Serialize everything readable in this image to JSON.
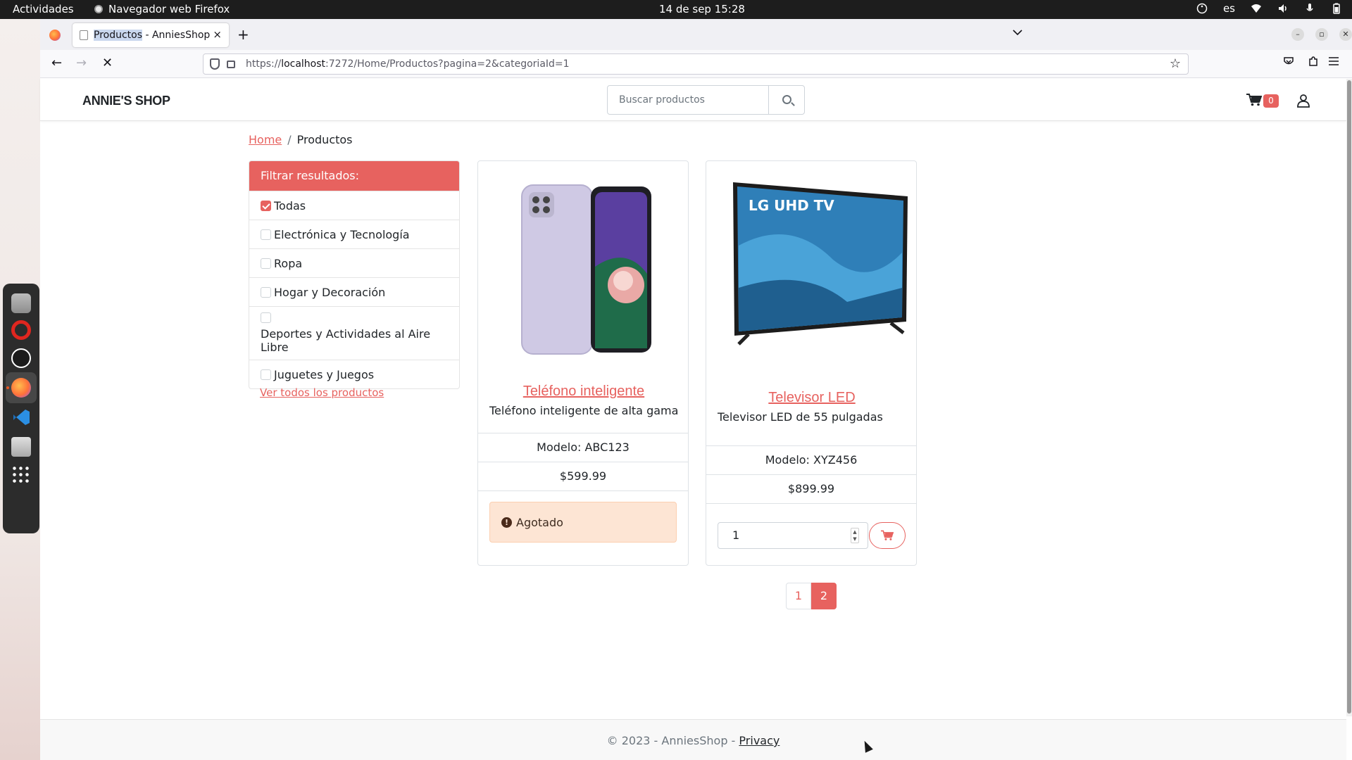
{
  "system": {
    "activities": "Actividades",
    "app_name": "Navegador web Firefox",
    "clock": "14 de sep  15:28",
    "language": "es"
  },
  "browser": {
    "tab_title_highlight": "Productos",
    "tab_title_rest": " - AnniesShop",
    "tab_close": "×",
    "new_tab": "+",
    "url_prefix": "https://",
    "url_host": "localhost",
    "url_rest": ":7272/Home/Productos?pagina=2&categoriaId=1",
    "star": "☆"
  },
  "site": {
    "brand": "ANNIE'S SHOP",
    "search_placeholder": "Buscar productos",
    "cart_count": "0",
    "accent_color": "#e7625f"
  },
  "breadcrumb": {
    "home": "Home",
    "separator": "/",
    "current": "Productos"
  },
  "filter": {
    "title": "Filtrar resultados:",
    "items": [
      {
        "label": "Todas",
        "checked": true
      },
      {
        "label": "Electrónica y Tecnología",
        "checked": false
      },
      {
        "label": "Ropa",
        "checked": false
      },
      {
        "label": "Hogar y Decoración",
        "checked": false
      },
      {
        "label": "Deportes y Actividades al Aire Libre",
        "checked": false
      },
      {
        "label": "Juguetes y Juegos",
        "checked": false
      }
    ],
    "see_all": "Ver todos los productos"
  },
  "products": [
    {
      "name": "Teléfono inteligente",
      "description": "Teléfono inteligente de alta gama",
      "model": "Modelo: ABC123",
      "price": "$599.99",
      "status": "Agotado"
    },
    {
      "name": "Televisor LED",
      "description": "Televisor LED de 55 pulgadas",
      "model": "Modelo: XYZ456",
      "price": "$899.99",
      "quantity": "1",
      "tv_brand_text": "LG UHD TV"
    }
  ],
  "pagination": {
    "pages": [
      "1",
      "2"
    ],
    "current": "2"
  },
  "footer": {
    "copyright": "© 2023 - AnniesShop - ",
    "privacy": "Privacy"
  }
}
